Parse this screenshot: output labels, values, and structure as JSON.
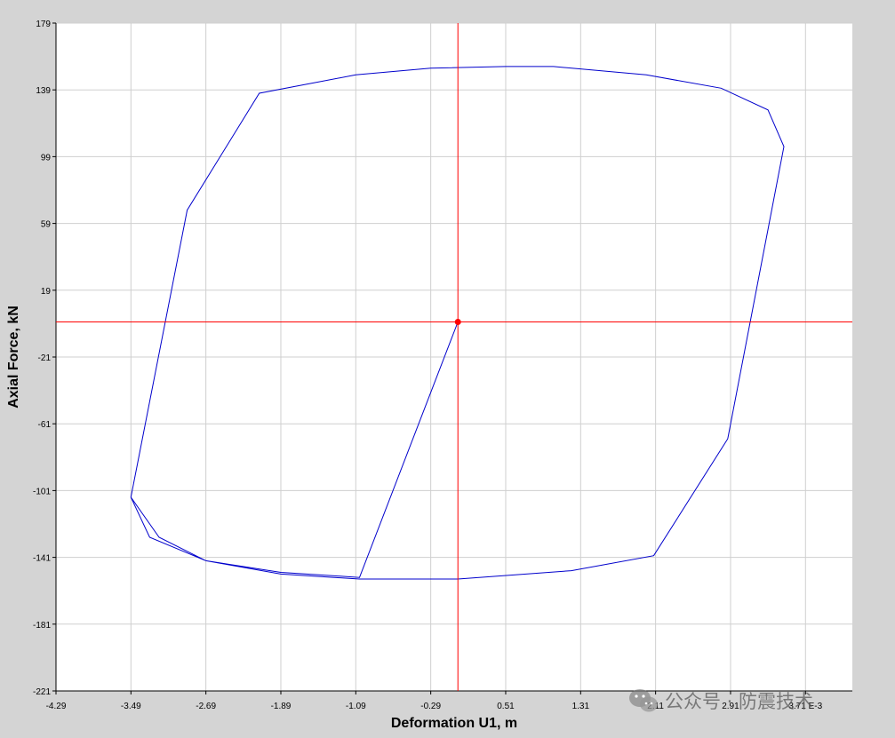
{
  "chart_data": {
    "type": "line",
    "xlabel": "Deformation U1, m",
    "ylabel": "Axial Force, kN",
    "x_scale_note": "E-3",
    "xlim": [
      -4.29,
      4.21
    ],
    "ylim": [
      -221,
      179
    ],
    "x_ticks": [
      "-4.29",
      "-3.49",
      "-2.69",
      "-1.89",
      "-1.09",
      "-0.29",
      "0.51",
      "1.31",
      "2.11",
      "2.91",
      "3.71"
    ],
    "y_ticks": [
      "179",
      "139",
      "99",
      "59",
      "19",
      "-21",
      "-61",
      "-101",
      "-141",
      "-181",
      "-221"
    ],
    "grid": true,
    "series": [
      {
        "color": "#0000cc",
        "x": [
          0.0,
          -1.05,
          -1.89,
          -2.69,
          -3.19,
          -3.49,
          -2.89,
          -2.12,
          -1.09,
          -0.29,
          0.51,
          1.02,
          2.01,
          2.81,
          3.31,
          3.48,
          2.88,
          2.09,
          1.21,
          0.0,
          -1.05,
          -1.89,
          -2.69,
          -3.29,
          -3.49
        ],
        "y": [
          0,
          -153,
          -150,
          -143,
          -129,
          -105,
          67,
          137,
          148,
          152,
          153,
          153,
          148,
          140,
          127,
          105,
          -70,
          -140,
          -149,
          -154,
          -154,
          -151,
          -143,
          -129,
          -105
        ]
      }
    ],
    "crosshair": {
      "x": 0.0,
      "y": 0.0,
      "color": "#ff0000"
    }
  },
  "watermark": {
    "text": "公众号 · 防震技术",
    "icon": "wechat-icon"
  }
}
